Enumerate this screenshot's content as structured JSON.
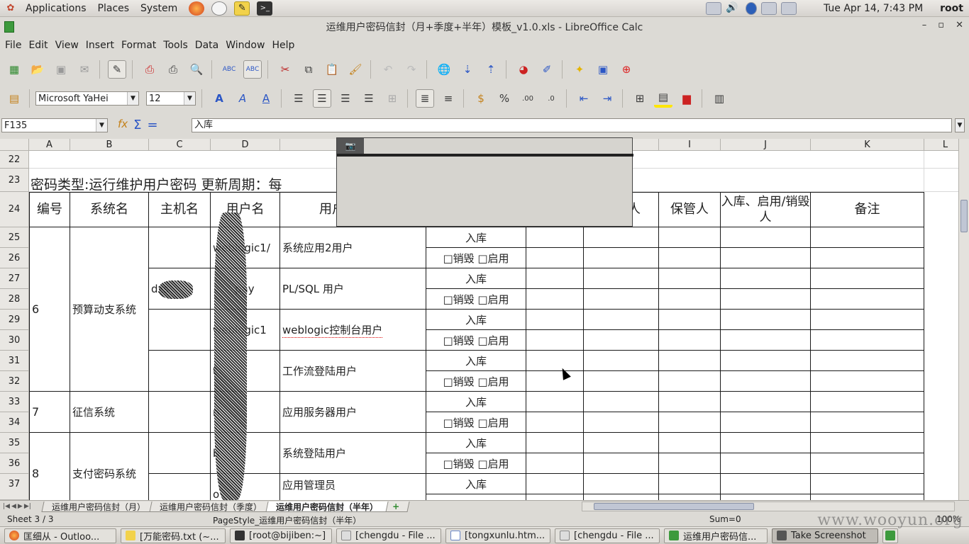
{
  "top_panel": {
    "menus": [
      "Applications",
      "Places",
      "System"
    ],
    "clock": "Tue Apr 14,  7:43 PM",
    "user": "root"
  },
  "window": {
    "title": "运维用户密码信封（月+季度+半年）模板_v1.0.xls - LibreOffice Calc",
    "buttons": [
      "–",
      "▫",
      "✕"
    ]
  },
  "menubar": [
    "File",
    "Edit",
    "View",
    "Insert",
    "Format",
    "Tools",
    "Data",
    "Window",
    "Help"
  ],
  "formatting": {
    "font_name": "Microsoft YaHei",
    "font_size": "12"
  },
  "formula_bar": {
    "cell_ref": "F135",
    "content": "入库"
  },
  "columns": [
    "A",
    "B",
    "C",
    "D",
    "E",
    "F",
    "G",
    "H",
    "I",
    "J",
    "K",
    "L"
  ],
  "rows": [
    "22",
    "23",
    "24",
    "25",
    "26",
    "27",
    "28",
    "29",
    "30",
    "31",
    "32",
    "33",
    "34",
    "35",
    "36",
    "37"
  ],
  "sheet": {
    "title_row": "密码类型:运行维护用户密码          更新周期：每",
    "headers": {
      "no": "编号",
      "system": "系统名",
      "host": "主机名",
      "user": "用户名",
      "usage": "用户",
      "h_partial": "人",
      "keeper": "保管人",
      "status": "入库、启用/销毁人",
      "remark": "备注"
    },
    "group6": {
      "no": "6",
      "system": "预算动支系统"
    },
    "group7": {
      "no": "7",
      "system": "征信系统"
    },
    "group8": {
      "no": "8",
      "system": "支付密码系统"
    },
    "host_27": "dzs",
    "users": [
      "weblogic1/",
      "pay",
      "weblogic1",
      "t",
      "n",
      "b",
      "o"
    ],
    "usages": [
      "系统应用2用户",
      "PL/SQL 用户",
      "weblogic控制台用户",
      "工作流登陆用户",
      "应用服务器用户",
      "系统登陆用户",
      "应用管理员"
    ],
    "status_in": "入库",
    "status_out": "□销毁 □启用"
  },
  "sheet_tabs": [
    "运维用户密码信封（月）",
    "运维用户密码信封（季度）",
    "运维用户密码信封（半年）"
  ],
  "status_bar": {
    "sheet": "Sheet 3 / 3",
    "page_style": "PageStyle_运维用户密码信封（半年）",
    "sum": "Sum=0",
    "zoom": "100%"
  },
  "taskbar": [
    "匡细从 - Outloo...",
    "[万能密码.txt (~...",
    "[root@bijiben:~]",
    "[chengdu - File ...",
    "[tongxunlu.htm...",
    "[chengdu - File ...",
    "运维用户密码信...",
    "Take Screenshot"
  ],
  "watermark": "www.wooyun.org"
}
